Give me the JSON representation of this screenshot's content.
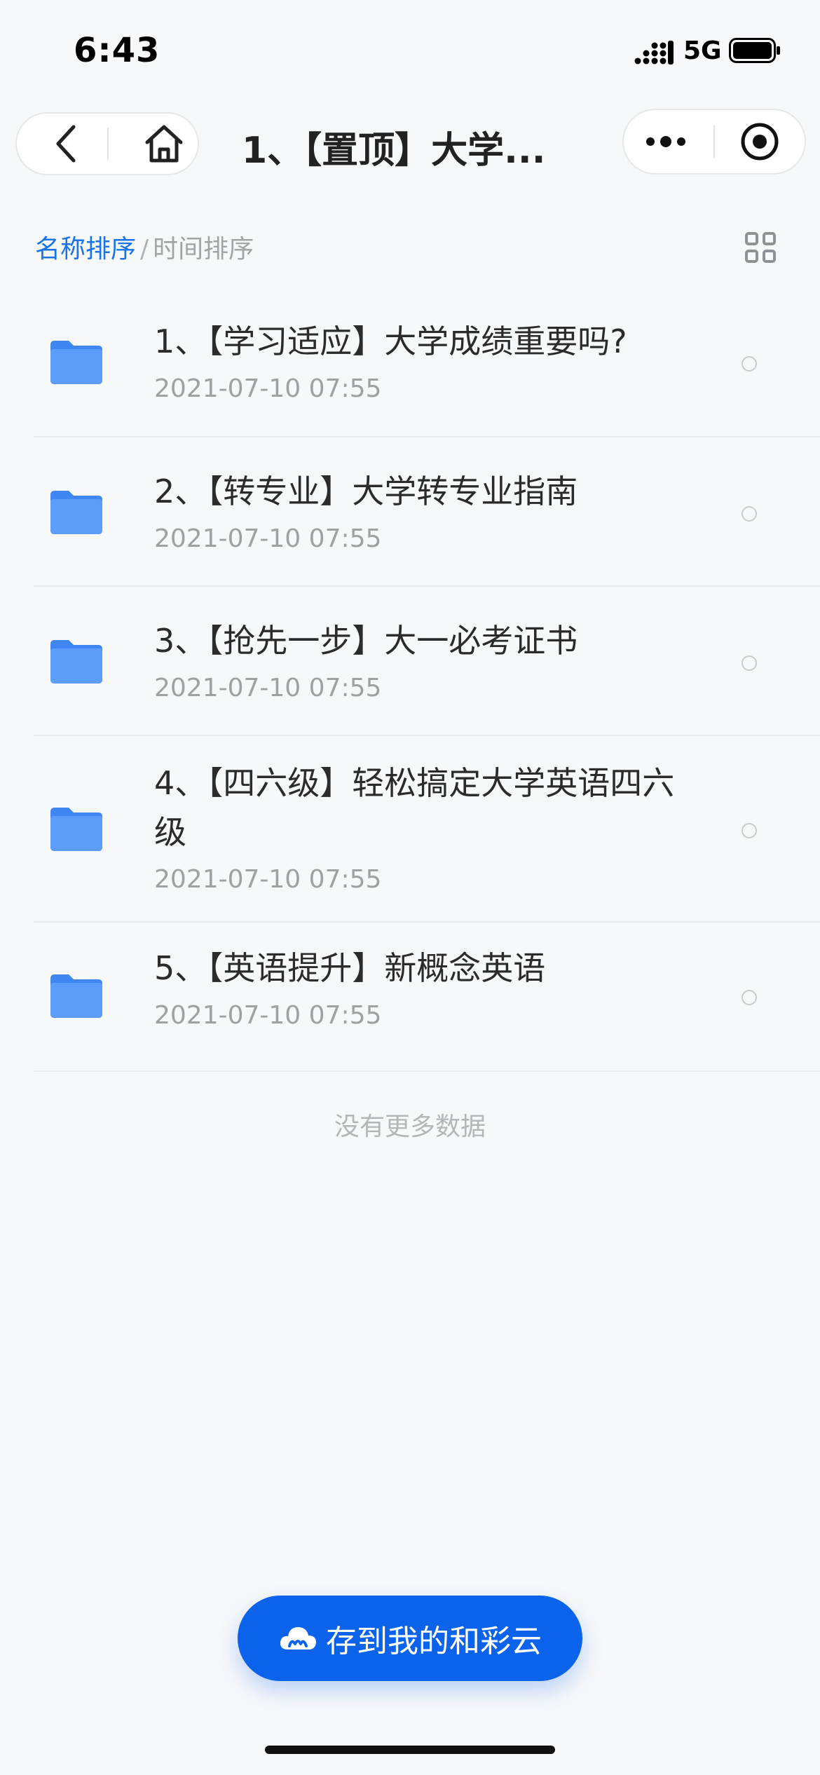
{
  "status": {
    "time": "6:43",
    "network": "5G"
  },
  "nav": {
    "title": "1、【置顶】大学..."
  },
  "sort": {
    "name_label": "名称排序",
    "divider": "/",
    "time_label": "时间排序"
  },
  "items": [
    {
      "title": "1、【学习适应】大学成绩重要吗?",
      "time": "2021-07-10 07:55"
    },
    {
      "title": "2、【转专业】大学转专业指南",
      "time": "2021-07-10 07:55"
    },
    {
      "title": "3、【抢先一步】大一必考证书",
      "time": "2021-07-10 07:55"
    },
    {
      "title": "4、【四六级】轻松搞定大学英语四六级",
      "time": "2021-07-10 07:55"
    },
    {
      "title": "5、【英语提升】新概念英语",
      "time": "2021-07-10 07:55"
    }
  ],
  "footer": {
    "no_more": "没有更多数据"
  },
  "save_button": {
    "label": "存到我的和彩云"
  },
  "colors": {
    "accent": "#0a63ea",
    "folder": "#4e94f7",
    "link": "#1a73e8"
  }
}
